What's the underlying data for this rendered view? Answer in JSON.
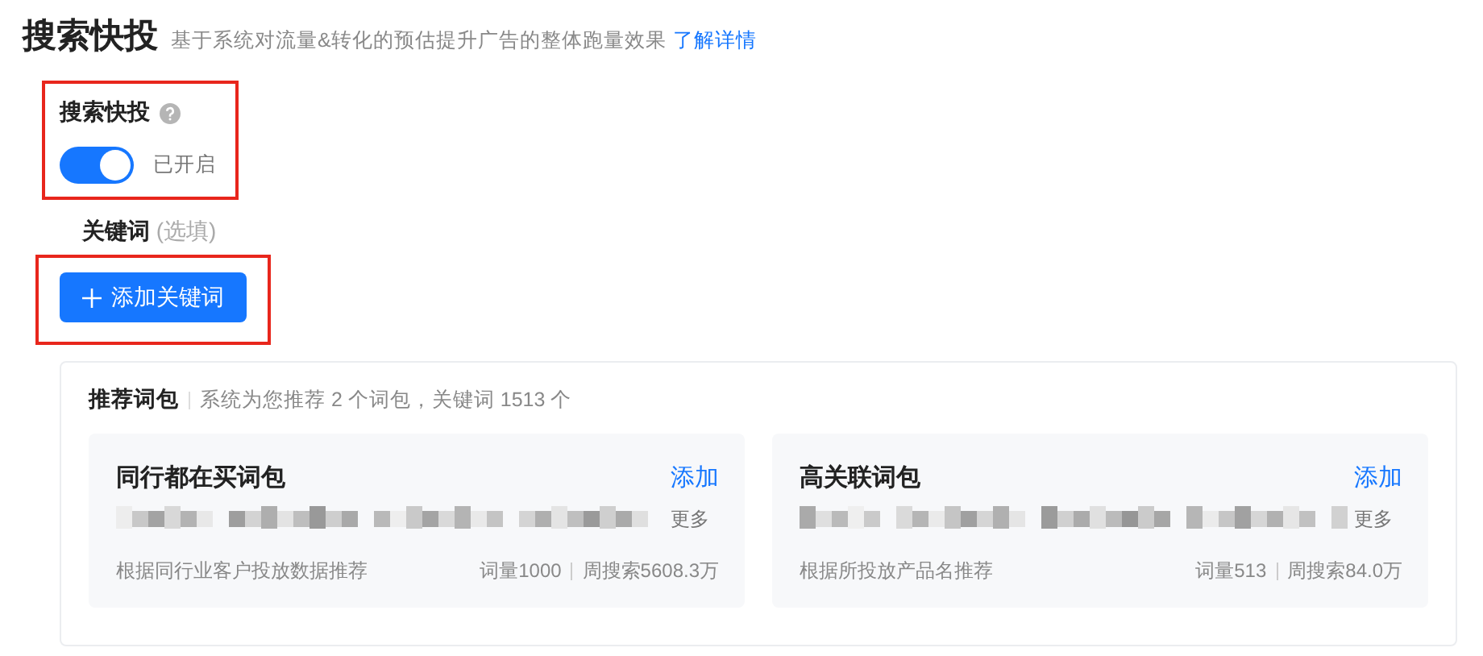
{
  "header": {
    "title": "搜索快投",
    "description": "基于系统对流量&转化的预估提升广告的整体跑量效果",
    "link": "了解详情"
  },
  "switch_section": {
    "label": "搜索快投",
    "highlighted": true,
    "on": true,
    "status": "已开启"
  },
  "keyword_section": {
    "label": "关键词",
    "hint": "(选填)",
    "highlighted": true,
    "button": "添加关键词"
  },
  "recommend": {
    "title": "推荐词包",
    "summary": "系统为您推荐 2 个词包，关键词 1513 个",
    "packs": [
      {
        "name": "同行都在买词包",
        "action": "添加",
        "more": "更多",
        "source": "根据同行业客户投放数据推荐",
        "count": "词量1000",
        "search": "周搜索5608.3万"
      },
      {
        "name": "高关联词包",
        "action": "添加",
        "more": "更多",
        "source": "根据所投放产品名推荐",
        "count": "词量513",
        "search": "周搜索84.0万"
      }
    ]
  }
}
